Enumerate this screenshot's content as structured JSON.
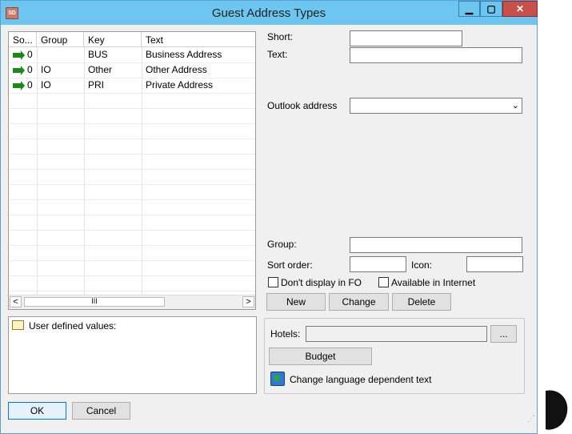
{
  "window": {
    "title": "Guest Address Types",
    "icon_text": "SD",
    "controls": {
      "minimize": "▁",
      "maximize": "▢",
      "close": "✕"
    }
  },
  "grid": {
    "columns": [
      "So...",
      "Group",
      "Key",
      "Text"
    ],
    "rows": [
      {
        "sort": "0",
        "group": "",
        "key": "BUS",
        "text": "Business Address"
      },
      {
        "sort": "0",
        "group": "IO",
        "key": "Other",
        "text": "Other Address"
      },
      {
        "sort": "0",
        "group": "IO",
        "key": "PRI",
        "text": "Private Address"
      }
    ],
    "scroll_left": "<",
    "scroll_right": ">",
    "scroll_thumb": "III"
  },
  "user_defined": {
    "label": "User defined values:"
  },
  "form": {
    "short_label": "Short:",
    "short_value": "",
    "text_label": "Text:",
    "text_value": "",
    "outlook_label": "Outlook address",
    "outlook_value": "",
    "outlook_arrow": "⌄",
    "group_label": "Group:",
    "group_value": "",
    "sort_label": "Sort order:",
    "sort_value": "",
    "icon_label": "Icon:",
    "icon_value": "",
    "dont_display_label": "Don't display in FO",
    "available_internet_label": "Available in Internet",
    "new_label": "New",
    "change_label": "Change",
    "delete_label": "Delete"
  },
  "hotels": {
    "label": "Hotels:",
    "value": "",
    "browse_label": "...",
    "budget_label": "Budget",
    "language_label": "Change language dependent text"
  },
  "footer": {
    "ok_label": "OK",
    "cancel_label": "Cancel"
  }
}
